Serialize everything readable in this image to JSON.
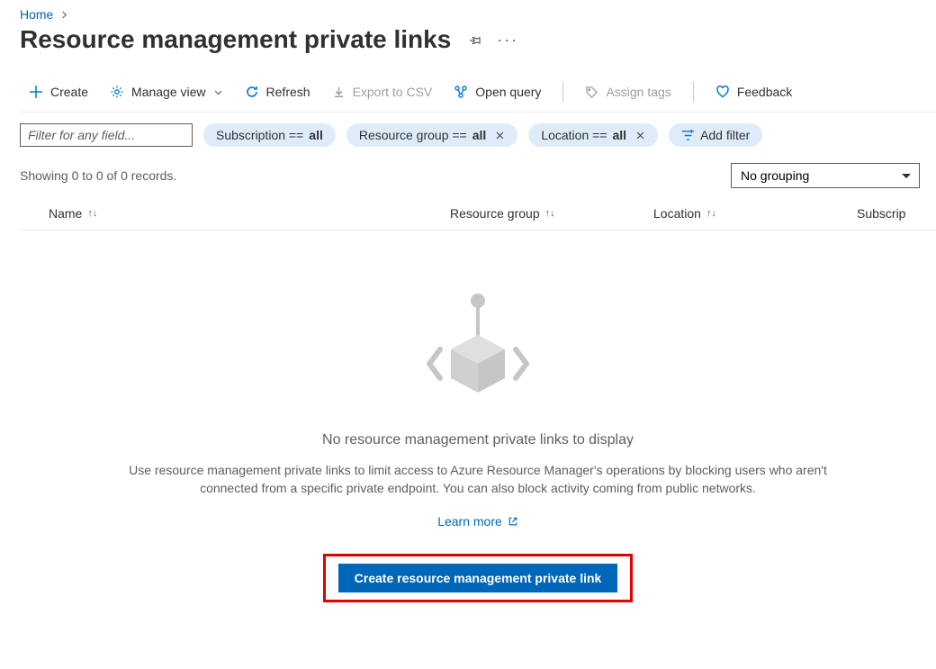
{
  "breadcrumb": {
    "home": "Home"
  },
  "title": "Resource management private links",
  "toolbar": {
    "create": "Create",
    "manage_view": "Manage view",
    "refresh": "Refresh",
    "export_csv": "Export to CSV",
    "open_query": "Open query",
    "assign_tags": "Assign tags",
    "feedback": "Feedback"
  },
  "filter": {
    "placeholder": "Filter for any field...",
    "subscription": {
      "label": "Subscription == ",
      "value": "all"
    },
    "resource_group": {
      "label": "Resource group == ",
      "value": "all"
    },
    "location": {
      "label": "Location == ",
      "value": "all"
    },
    "add_filter": "Add filter"
  },
  "showing": "Showing 0 to 0 of 0 records.",
  "grouping": {
    "selected": "No grouping"
  },
  "columns": {
    "name": "Name",
    "resource_group": "Resource group",
    "location": "Location",
    "subscription": "Subscrip"
  },
  "empty": {
    "heading": "No resource management private links to display",
    "body": "Use resource management private links to limit access to Azure Resource Manager's operations by blocking users who aren't connected from a specific private endpoint. You can also block activity coming from public networks.",
    "learn_more": "Learn more",
    "cta": "Create resource management private link"
  }
}
